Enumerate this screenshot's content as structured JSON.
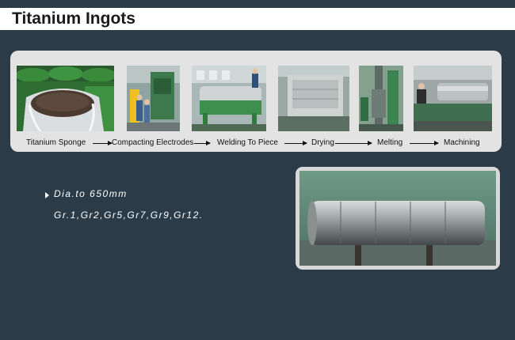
{
  "title": "Titanium Ingots",
  "process": {
    "steps": [
      {
        "label": "Titanium  Sponge",
        "image": "titanium-sponge-drums-photo"
      },
      {
        "label": "Compacting Electrodes",
        "image": "compacting-press-photo"
      },
      {
        "label": "Welding To Piece",
        "image": "welding-workshop-photo"
      },
      {
        "label": "Drying",
        "image": "drying-oven-photo"
      },
      {
        "label": "Melting",
        "image": "melting-furnace-photo"
      },
      {
        "label": "Machining",
        "image": "lathe-machining-photo"
      }
    ]
  },
  "specs": {
    "diameter": "Dia.to 650mm",
    "grades": "Gr.1,Gr2,Gr5,Gr7,Gr9,Gr12."
  },
  "colors": {
    "background": "#2b3b47",
    "title_bar": "#ffffff",
    "panel": "#e3e3e3",
    "machine_green": "#2f8f4e"
  }
}
